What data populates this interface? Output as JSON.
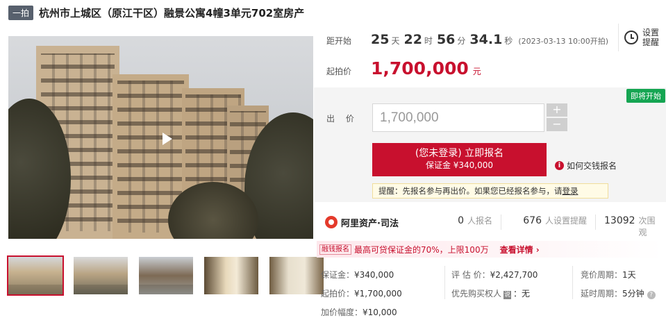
{
  "header": {
    "auction_tag": "一拍",
    "title": "杭州市上城区（原江干区）融景公寓4幢3单元702室房产"
  },
  "gallery": {
    "thumbnail_count": 5
  },
  "countdown": {
    "label": "距开始",
    "days": "25",
    "days_unit": "天",
    "hours": "22",
    "hours_unit": "时",
    "minutes": "56",
    "minutes_unit": "分",
    "seconds": "34.1",
    "seconds_unit": "秒",
    "start_note": "(2023-03-13 10:00开拍)"
  },
  "remind": {
    "label": "设置提醒"
  },
  "start_price": {
    "label": "起拍价",
    "value": "1,700,000",
    "unit": "元"
  },
  "bid": {
    "status_badge": "即将开始",
    "label": "出 价",
    "input_value": "1,700,000",
    "plus": "+",
    "minus": "−",
    "signup_main": "(您未登录) 立即报名",
    "signup_sub": "保证金 ¥340,000",
    "how_link": "如何交钱报名",
    "tip_prefix": "提醒：先报名参与再出价。如果您已经报名参与，请",
    "tip_login": "登录"
  },
  "stats": {
    "brand": "阿里资产·司法",
    "signups_num": "0",
    "signups_label": "人报名",
    "reminders_num": "676",
    "reminders_label": "人设置提醒",
    "views_num": "13092",
    "views_label": "次围观"
  },
  "loan": {
    "tag": "融钱报名",
    "text": "最高可贷保证金的70%，上限100万",
    "link": "查看详情 ›"
  },
  "details": {
    "deposit_label": "保证金：",
    "deposit_value": "¥340,000",
    "appraisal_label": "评 估 价：",
    "appraisal_value": "¥2,427,700",
    "cycle_label": "竞价周期：",
    "cycle_value": "1天",
    "start_label": "起拍价：",
    "start_value": "¥1,700,000",
    "priority_label": "优先购买权人",
    "priority_tag": "说",
    "priority_value": "：无",
    "delay_label": "延时周期：",
    "delay_value": "5分钟",
    "increment_label": "加价幅度：",
    "increment_value": "¥10,000"
  },
  "colors": {
    "accent": "#c8102e",
    "badge_green": "#15a552",
    "panel_bg": "#f4f4f4"
  },
  "icons": [
    "play-icon",
    "alarm-clock-icon",
    "info-icon",
    "alibaba-logo-icon",
    "help-icon"
  ]
}
